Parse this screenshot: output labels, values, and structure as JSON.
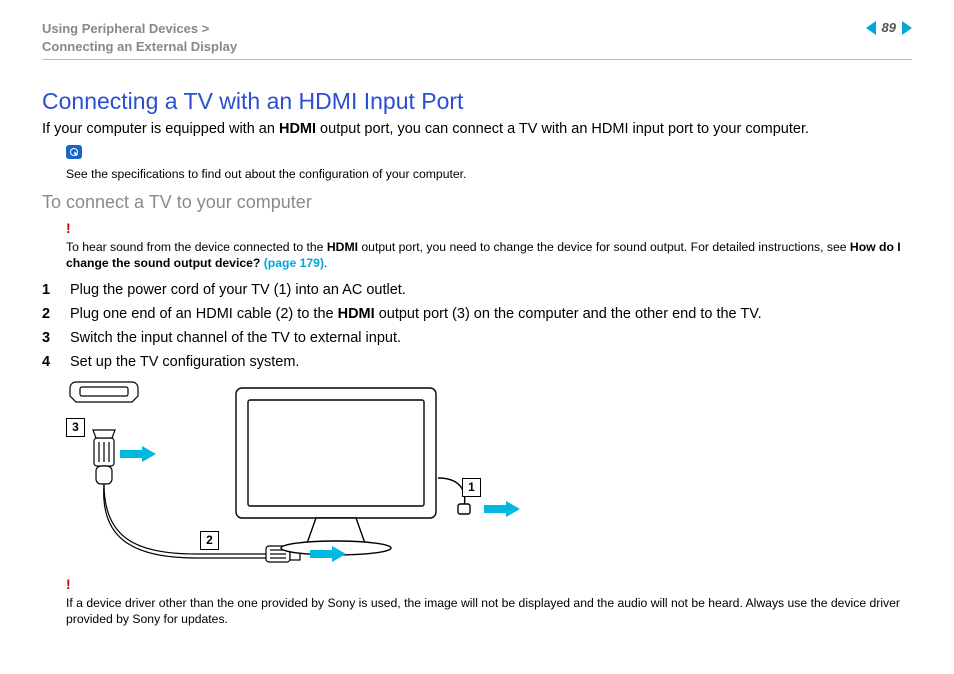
{
  "breadcrumb": {
    "line1": "Using Peripheral Devices >",
    "line2": "Connecting an External Display"
  },
  "page_number": "89",
  "heading": "Connecting a TV with an HDMI Input Port",
  "intro_a": "If your computer is equipped with an ",
  "intro_bold": "HDMI",
  "intro_b": " output port, you can connect a TV with an HDMI input port to your computer.",
  "note_text": "See the specifications to find out about the configuration of your computer.",
  "subheading": "To connect a TV to your computer",
  "warn1_a": "To hear sound from the device connected to the ",
  "warn1_bold1": "HDMI",
  "warn1_b": " output port, you need to change the device for sound output. For detailed instructions, see ",
  "warn1_bold2": "How do I change the sound output device? ",
  "warn1_link": "(page 179)",
  "warn1_c": ".",
  "steps": [
    {
      "n": "1",
      "t": "Plug the power cord of your TV (1) into an AC outlet."
    },
    {
      "n": "2",
      "a": "Plug one end of an HDMI cable (2) to the ",
      "bold": "HDMI",
      "b": " output port (3) on the computer and the other end to the TV."
    },
    {
      "n": "3",
      "t": "Switch the input channel of the TV to external input."
    },
    {
      "n": "4",
      "t": "Set up the TV configuration system."
    }
  ],
  "callouts": {
    "c1": "1",
    "c2": "2",
    "c3": "3"
  },
  "warn2": "If a device driver other than the one provided by Sony is used, the image will not be displayed and the audio will not be heard. Always use the device driver provided by Sony for updates."
}
